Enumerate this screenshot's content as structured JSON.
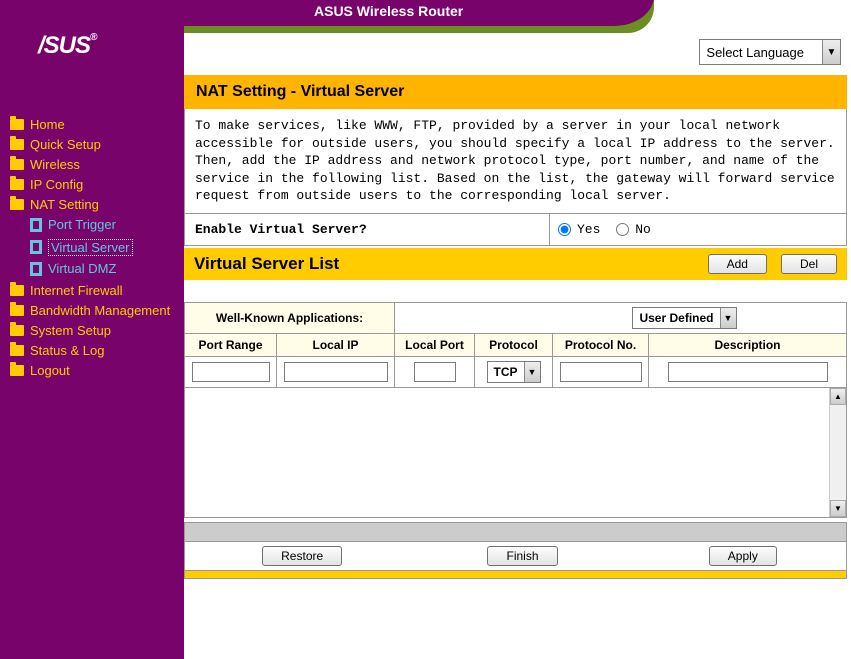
{
  "header": {
    "product": "ASUS Wireless Router",
    "logo": "/SUS",
    "logo_r": "®"
  },
  "language": {
    "label": "Select Language"
  },
  "sidebar": {
    "items": [
      {
        "label": "Home"
      },
      {
        "label": "Quick Setup"
      },
      {
        "label": "Wireless"
      },
      {
        "label": "IP Config"
      },
      {
        "label": "NAT Setting",
        "open": true,
        "children": [
          {
            "label": "Port Trigger"
          },
          {
            "label": "Virtual Server",
            "selected": true
          },
          {
            "label": "Virtual DMZ"
          }
        ]
      },
      {
        "label": "Internet Firewall"
      },
      {
        "label": "Bandwidth Management"
      },
      {
        "label": "System Setup"
      },
      {
        "label": "Status & Log"
      },
      {
        "label": "Logout"
      }
    ]
  },
  "page": {
    "title": "NAT Setting - Virtual Server",
    "description": "To make services, like WWW, FTP, provided by a server in your local network accessible for outside users, you should specify a local IP address to the server. Then, add the IP address and network protocol type, port number, and name of the service in the following list. Based on the list, the gateway will forward service request from outside users to the corresponding local server.",
    "enable_label": "Enable Virtual Server?",
    "enable_options": {
      "yes": "Yes",
      "no": "No"
    },
    "enable_value": "yes"
  },
  "list": {
    "heading": "Virtual Server List",
    "add": "Add",
    "del": "Del",
    "wka_label": "Well-Known Applications:",
    "wka_value": "User Defined",
    "columns": {
      "port_range": "Port Range",
      "local_ip": "Local IP",
      "local_port": "Local Port",
      "protocol": "Protocol",
      "protocol_no": "Protocol No.",
      "description": "Description"
    },
    "row": {
      "port_range": "",
      "local_ip": "",
      "local_port": "",
      "protocol": "TCP",
      "protocol_no": "",
      "description": ""
    }
  },
  "footer": {
    "restore": "Restore",
    "finish": "Finish",
    "apply": "Apply"
  }
}
